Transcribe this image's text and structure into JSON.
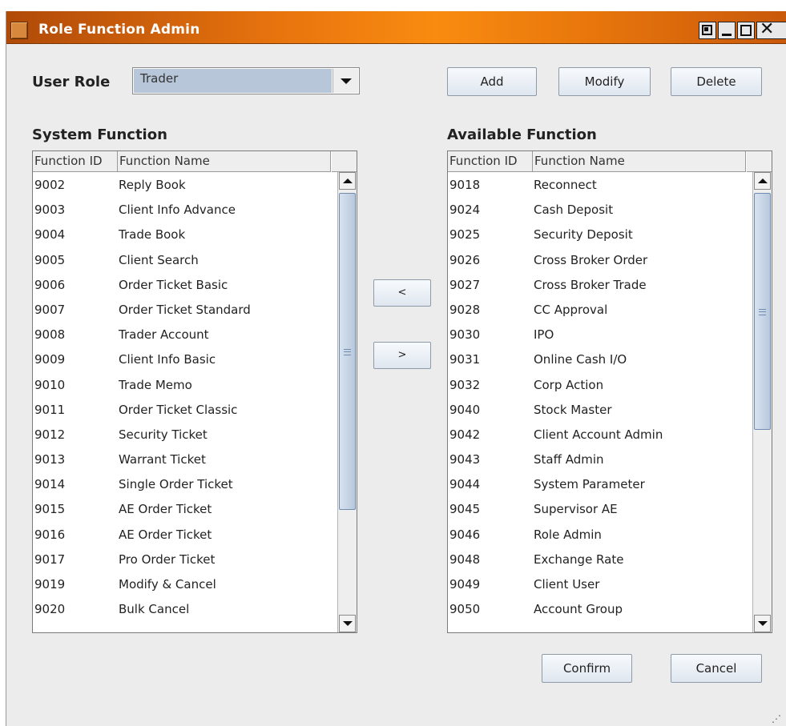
{
  "window": {
    "title": "Role Function Admin",
    "controls": [
      "restore-icon",
      "minimize-icon",
      "maximize-icon",
      "close-icon"
    ]
  },
  "user_role": {
    "label": "User Role",
    "selected": "Trader"
  },
  "actions": {
    "add": "Add",
    "modify": "Modify",
    "delete": "Delete",
    "move_left": "<",
    "move_right": ">",
    "confirm": "Confirm",
    "cancel": "Cancel"
  },
  "system_function": {
    "title": "System Function",
    "columns": [
      "Function ID",
      "Function Name"
    ],
    "rows": [
      [
        "9002",
        "Reply Book"
      ],
      [
        "9003",
        "Client Info Advance"
      ],
      [
        "9004",
        "Trade Book"
      ],
      [
        "9005",
        "Client Search"
      ],
      [
        "9006",
        "Order Ticket Basic"
      ],
      [
        "9007",
        "Order Ticket Standard"
      ],
      [
        "9008",
        "Trader Account"
      ],
      [
        "9009",
        "Client Info Basic"
      ],
      [
        "9010",
        "Trade Memo"
      ],
      [
        "9011",
        "Order Ticket Classic"
      ],
      [
        "9012",
        "Security Ticket"
      ],
      [
        "9013",
        "Warrant Ticket"
      ],
      [
        "9014",
        "Single Order Ticket"
      ],
      [
        "9015",
        "AE Order Ticket"
      ],
      [
        "9016",
        "AE Order Ticket"
      ],
      [
        "9017",
        "Pro Order Ticket"
      ],
      [
        "9019",
        "Modify & Cancel"
      ],
      [
        "9020",
        "Bulk Cancel"
      ]
    ]
  },
  "available_function": {
    "title": "Available Function",
    "columns": [
      "Function ID",
      "Function Name"
    ],
    "rows": [
      [
        "9018",
        "Reconnect"
      ],
      [
        "9024",
        "Cash Deposit"
      ],
      [
        "9025",
        "Security Deposit"
      ],
      [
        "9026",
        "Cross Broker Order"
      ],
      [
        "9027",
        "Cross Broker Trade"
      ],
      [
        "9028",
        "CC Approval"
      ],
      [
        "9030",
        "IPO"
      ],
      [
        "9031",
        "Online Cash I/O"
      ],
      [
        "9032",
        "Corp Action"
      ],
      [
        "9040",
        "Stock Master"
      ],
      [
        "9042",
        "Client Account Admin"
      ],
      [
        "9043",
        "Staff Admin"
      ],
      [
        "9044",
        "System Parameter"
      ],
      [
        "9045",
        "Supervisor AE"
      ],
      [
        "9046",
        "Role Admin"
      ],
      [
        "9048",
        "Exchange Rate"
      ],
      [
        "9049",
        "Client User"
      ],
      [
        "9050",
        "Account Group"
      ]
    ]
  },
  "colors": {
    "titlebar_accent": "#f98b10",
    "selection": "#b7c6d8",
    "background": "#ececec"
  }
}
